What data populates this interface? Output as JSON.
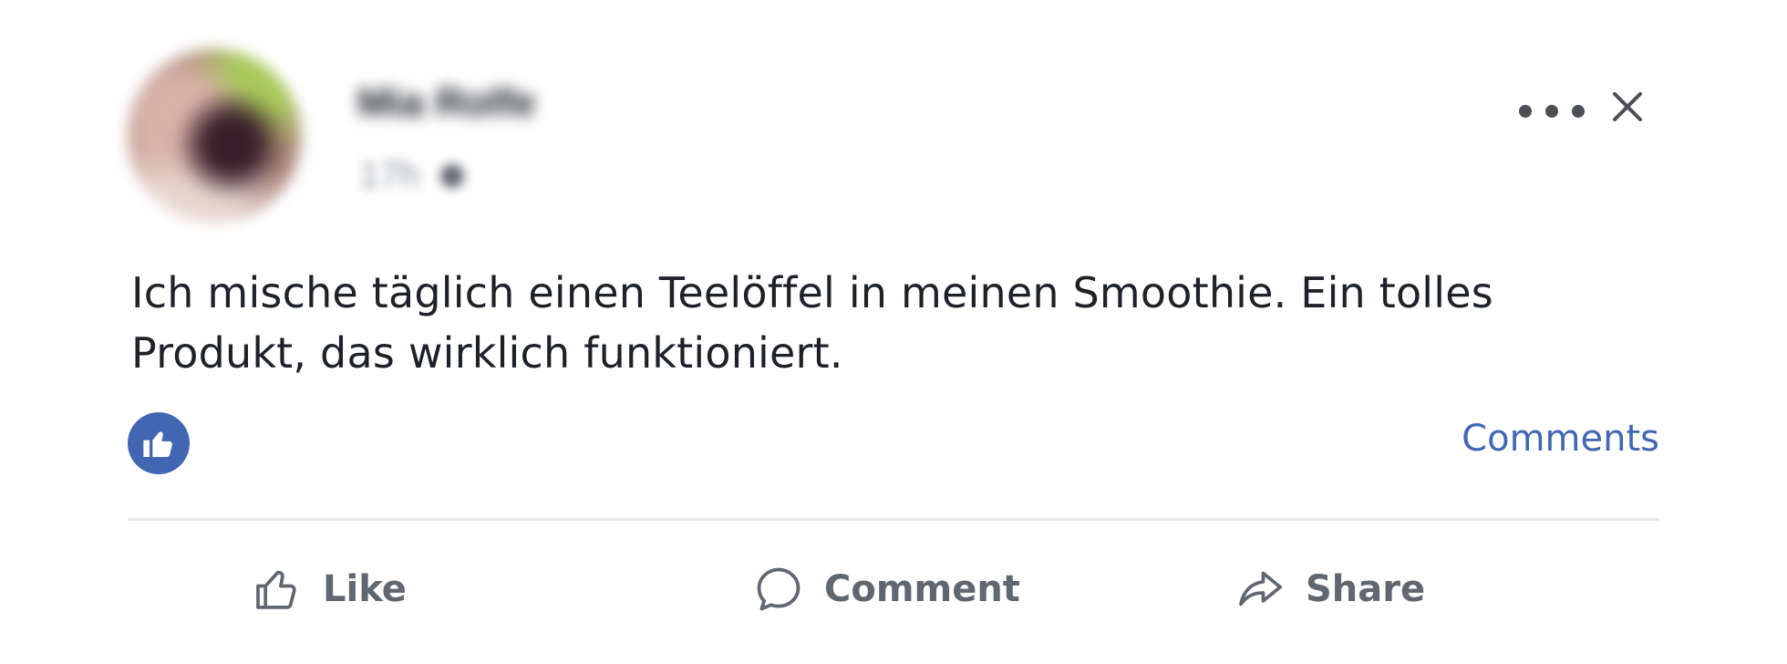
{
  "post": {
    "author_name": "Mia Rolfe",
    "timestamp": "17h",
    "text": "Ich mische täglich einen Teelöffel in meinen Smoothie. Ein tolles Produkt, das wirklich funktioniert.",
    "comments_link": "Comments"
  },
  "actions": {
    "like": "Like",
    "comment": "Comment",
    "share": "Share"
  },
  "colors": {
    "accent": "#4267b2",
    "action_text": "#606770",
    "divider": "#e5e5e5"
  },
  "icons": {
    "more": "more-horizontal-icon",
    "close": "close-icon",
    "reaction": "thumbs-up-icon",
    "like": "thumbs-up-outline-icon",
    "comment": "speech-bubble-icon",
    "share": "share-arrow-icon"
  }
}
